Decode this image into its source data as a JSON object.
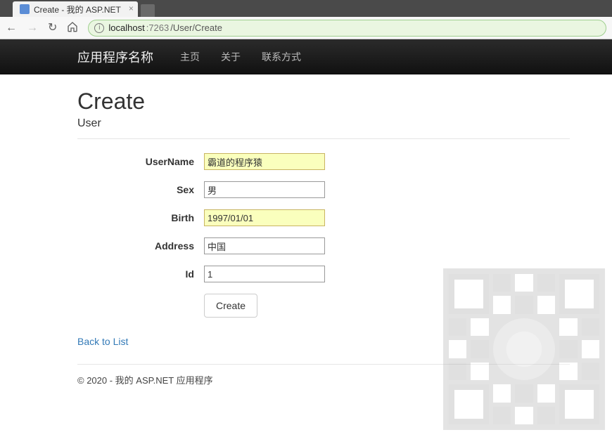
{
  "browser": {
    "tab_title": "Create - 我的 ASP.NET",
    "url_host": "localhost",
    "url_port": ":7263",
    "url_path": "/User/Create"
  },
  "navbar": {
    "brand": "应用程序名称",
    "links": {
      "home": "主页",
      "about": "关于",
      "contact": "联系方式"
    }
  },
  "page": {
    "title": "Create",
    "subhead": "User"
  },
  "form": {
    "labels": {
      "username": "UserName",
      "sex": "Sex",
      "birth": "Birth",
      "address": "Address",
      "id": "Id"
    },
    "values": {
      "username": "霸道的程序猿",
      "sex": "男",
      "birth": "1997/01/01",
      "address": "中国",
      "id": "1"
    },
    "submit_label": "Create"
  },
  "back_link": "Back to List",
  "footer": "© 2020 - 我的 ASP.NET 应用程序"
}
